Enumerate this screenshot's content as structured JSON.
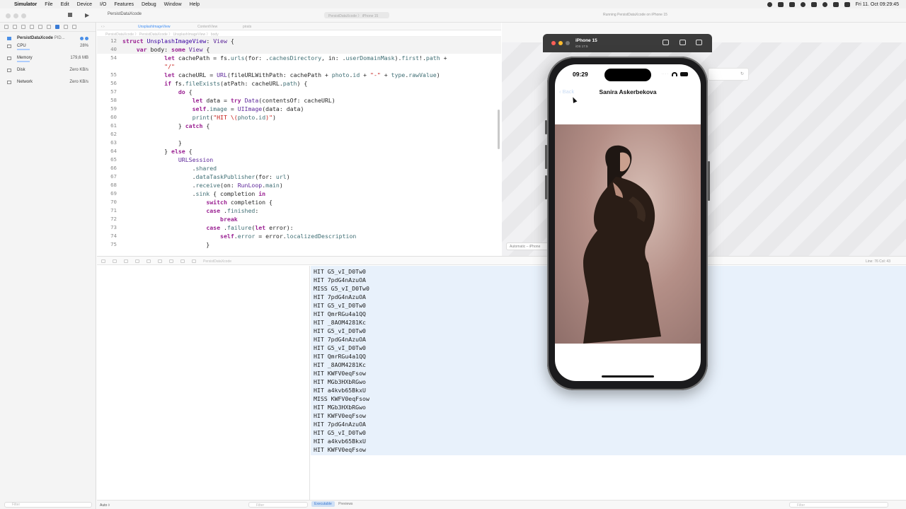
{
  "menubar": {
    "app": "Simulator",
    "items": [
      "File",
      "Edit",
      "Device",
      "I/O",
      "Features",
      "Debug",
      "Window",
      "Help"
    ],
    "clock": "Fri 11. Oct 09:29:45"
  },
  "toolbar": {
    "project": "PersistDataXcode",
    "scheme": "PersistDataXcode",
    "device": "iPhone 15",
    "status": "Running PersistDataXcode on iPhone 15"
  },
  "sidebar": {
    "project": {
      "name": "PersistDataXcode",
      "pid": "PID..."
    },
    "gauges": [
      {
        "label": "CPU",
        "value": "28%"
      },
      {
        "label": "Memory",
        "value": "179,6 MB"
      },
      {
        "label": "Disk",
        "value": "Zero KB/s"
      },
      {
        "label": "Network",
        "value": "Zero KB/s"
      }
    ],
    "filter_placeholder": "Filter"
  },
  "editor": {
    "tabs": [
      "UnsplashImageView",
      "ContentView",
      "pirats"
    ],
    "breadcrumb": "PersistDataXcode 〉 PersistDataXcode 〉 UnsplashImageView 〉 body",
    "lines": [
      {
        "n": "12",
        "sticky": true,
        "html": "<span class='kw'>struct</span> <span class='ty'>UnsplashImageView</span>: <span class='pr'>View</span> {"
      },
      {
        "n": "40",
        "sticky": true,
        "html": "    <span class='kw'>var</span> body: <span class='kw'>some</span> <span class='pr'>View</span> {"
      },
      {
        "n": "54",
        "html": "            <span class='kw'>let</span> cachePath = fs.<span class='fn'>urls</span>(for: .<span class='fn'>cachesDirectory</span>, in: .<span class='fn'>userDomainMask</span>).<span class='fn'>first</span>!.<span class='fn'>path</span> +"
      },
      {
        "n": "",
        "html": "            <span class='st'>\"/\"</span>"
      },
      {
        "n": "55",
        "html": "            <span class='kw'>let</span> cacheURL = <span class='pr'>URL</span>(fileURLWithPath: cachePath + <span class='fn'>photo</span>.<span class='fn'>id</span> + <span class='st'>\"-\"</span> + <span class='fn'>type</span>.<span class='fn'>rawValue</span>)"
      },
      {
        "n": "56",
        "html": "            <span class='kw'>if</span> fs.<span class='fn'>fileExists</span>(atPath: cacheURL.<span class='fn'>path</span>) {"
      },
      {
        "n": "57",
        "html": "                <span class='kw'>do</span> {"
      },
      {
        "n": "58",
        "html": "                    <span class='kw'>let</span> data = <span class='kw'>try</span> <span class='pr'>Data</span>(contentsOf: cacheURL)"
      },
      {
        "n": "59",
        "html": "                    <span class='kw'>self</span>.<span class='fn'>image</span> = <span class='pr'>UIImage</span>(data: data)"
      },
      {
        "n": "60",
        "html": "                    <span class='fn'>print</span>(<span class='st'>\"HIT \\(</span><span class='fn'>photo</span>.<span class='fn'>id</span><span class='st'>)\"</span>)"
      },
      {
        "n": "61",
        "html": "                } <span class='kw'>catch</span> {"
      },
      {
        "n": "62",
        "html": ""
      },
      {
        "n": "63",
        "html": "                }"
      },
      {
        "n": "64",
        "html": "            } <span class='kw'>else</span> {"
      },
      {
        "n": "65",
        "html": "                <span class='pr'>URLSession</span>"
      },
      {
        "n": "66",
        "html": "                    .<span class='fn'>shared</span>"
      },
      {
        "n": "67",
        "html": "                    .<span class='fn'>dataTaskPublisher</span>(for: <span class='fn'>url</span>)"
      },
      {
        "n": "68",
        "html": "                    .<span class='fn'>receive</span>(on: <span class='pr'>RunLoop</span>.<span class='fn'>main</span>)"
      },
      {
        "n": "69",
        "html": "                    .<span class='fn'>sink</span> { completion <span class='kw'>in</span>"
      },
      {
        "n": "70",
        "html": "                        <span class='kw'>switch</span> completion {"
      },
      {
        "n": "71",
        "html": "                        <span class='kw'>case</span> .<span class='fn'>finished</span>:"
      },
      {
        "n": "72",
        "html": "                            <span class='kw'>break</span>"
      },
      {
        "n": "73",
        "html": "                        <span class='kw'>case</span> .<span class='fn'>failure</span>(<span class='kw'>let</span> error):"
      },
      {
        "n": "74",
        "html": "                            <span class='kw'>self</span>.<span class='fn'>error</span> = error.<span class='fn'>localizedDescription</span>"
      },
      {
        "n": "75",
        "html": "                        }"
      }
    ]
  },
  "canvas": {
    "device_pill": "Automatic – iPhone"
  },
  "debugbar": {
    "target": "PersistDataXcode",
    "line_col": "Line: 76  Col: 43"
  },
  "console": {
    "lines": [
      "HIT G5_vI_D0Tw0",
      "HIT 7pdG4nAzuOA",
      "MISS G5_vI_D0Tw0",
      "HIT 7pdG4nAzuOA",
      "HIT G5_vI_D0Tw0",
      "HIT QmrRGu4a1QQ",
      "HIT _8AOM4281Kc",
      "HIT G5_vI_D0Tw0",
      "HIT 7pdG4nAzuOA",
      "HIT G5_vI_D0Tw0",
      "HIT QmrRGu4a1QQ",
      "HIT _8AOM4281Kc",
      "HIT KWFV0eqFsow",
      "HIT MGb3HXbRGwo",
      "HIT a4kvb65BkxU",
      "MISS KWFV0eqFsow",
      "HIT MGb3HXbRGwo",
      "HIT KWFV0eqFsow",
      "HIT 7pdG4nAzuOA",
      "HIT G5_vI_D0Tw0",
      "HIT a4kvb65BkxU",
      "HIT KWFV0eqFsow"
    ]
  },
  "bottombar": {
    "auto": "Auto ◊",
    "filter": "Filter",
    "seg_executable": "Executable",
    "seg_previews": "Previews",
    "filter_right": "Filter"
  },
  "simulator": {
    "device": "iPhone 15",
    "os": "iOS 17.5",
    "time": "09:29",
    "back_label": "Back",
    "nav_title": "Sanira Askerbekova"
  },
  "colors": {
    "accent": "#3e8df5",
    "console_bg": "#e8f1fb",
    "keyword": "#9b2393"
  }
}
